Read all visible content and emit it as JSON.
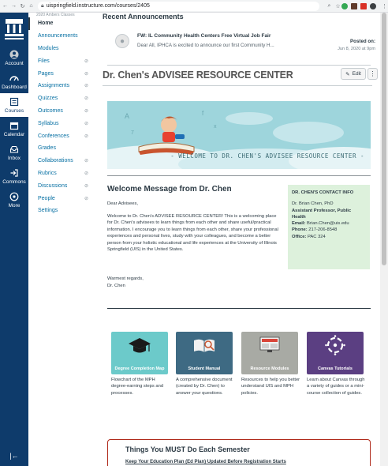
{
  "browser": {
    "url": "uispringfield.instructure.com/courses/2405"
  },
  "global_nav": {
    "items": [
      {
        "label": "Account"
      },
      {
        "label": "Dashboard"
      },
      {
        "label": "Courses"
      },
      {
        "label": "Calendar"
      },
      {
        "label": "Inbox"
      },
      {
        "label": "Commons"
      },
      {
        "label": "More"
      }
    ]
  },
  "course_nav": {
    "term": "2020 Ambers Classes",
    "links": [
      {
        "label": "Home"
      },
      {
        "label": "Announcements"
      },
      {
        "label": "Modules"
      },
      {
        "label": "Files"
      },
      {
        "label": "Pages"
      },
      {
        "label": "Assignments"
      },
      {
        "label": "Quizzes"
      },
      {
        "label": "Outcomes"
      },
      {
        "label": "Syllabus"
      },
      {
        "label": "Conferences"
      },
      {
        "label": "Grades"
      },
      {
        "label": "Collaborations"
      },
      {
        "label": "Rubrics"
      },
      {
        "label": "Discussions"
      },
      {
        "label": "People"
      },
      {
        "label": "Settings"
      }
    ]
  },
  "recent": {
    "heading": "Recent Announcements",
    "title": "FW: IL Community Health Centers Free Virtual Job Fair",
    "body": "Dear All,  IPHCA is excited to announce our first Community H...",
    "posted_label": "Posted on:",
    "posted_date": "Jun 8, 2020 at 9pm"
  },
  "page": {
    "title": "Dr. Chen's ADVISEE RESOURCE CENTER",
    "edit_label": "Edit",
    "banner_text": "- WELCOME TO DR. CHEN'S ADVISEE RESOURCE CENTER -"
  },
  "welcome": {
    "heading": "Welcome Message from Dr. Chen",
    "greeting": "Dear Advisees,",
    "body": "Welcome to Dr. Chen's ADVISEE RESOURCE CENTER! This is a welcoming place for Dr. Chen's advisees to learn things from each other and share useful/practical information. I encourage you to learn things from each other, share your professional experiences and personal lives, study with your colleagues, and become a better person from your holistic educational and life experiences at the University of Illinois Springfield (UIS) in the United States.",
    "regards": "Warmest regards,",
    "sign": "Dr. Chen"
  },
  "contact": {
    "heading": "DR. CHEN'S CONTACT INFO",
    "name": "Dr. Brian Chen, PhD",
    "role": "Assistant Professor, Public Health",
    "email_label": "Email:",
    "email": "Brian.Chen@uis.edu",
    "phone_label": "Phone:",
    "phone": "217-206-8548",
    "office_label": "Office:",
    "office": "PAC 324"
  },
  "cards": [
    {
      "tile": "Degree Completion Map",
      "desc": "Flowchart of the MPH degree-earning steps and processes.",
      "color": "#6ccaca"
    },
    {
      "tile": "Student Manual",
      "desc": "A comprehensive document (created by Dr. Chen) to answer your questions.",
      "color": "#3e6a83"
    },
    {
      "tile": "Resource Modules",
      "desc": "Resources to help you better understand UIS and MPH policies.",
      "color": "#a8aaa4"
    },
    {
      "tile": "Canvas Tutorials",
      "desc": "Learn about Canvas through a variety of guides or a mini-course collection of guides.",
      "color": "#5b3f82"
    }
  ],
  "must": {
    "heading": "Things You MUST Do Each Semester",
    "sub": "Keep Your Education Plan (Ed Plan) Updated Before Registration Starts"
  },
  "colors": {
    "global_nav_bg": "#0e3b6b",
    "link": "#0770a3",
    "contact_bg": "#ddf1dc",
    "must_border": "#b02b1c"
  }
}
